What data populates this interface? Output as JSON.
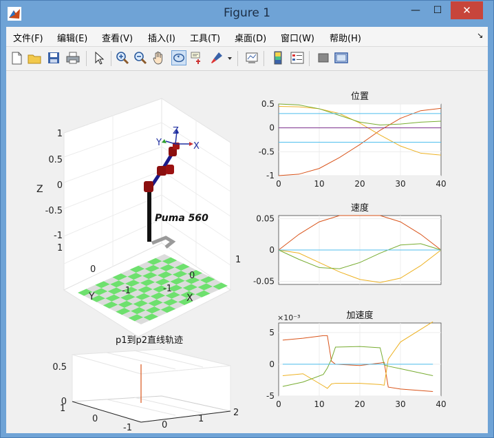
{
  "window": {
    "title": "Figure 1",
    "minimize": "—",
    "maximize": "☐",
    "close": "✕"
  },
  "menu": [
    "文件(F)",
    "编辑(E)",
    "查看(V)",
    "插入(I)",
    "工具(T)",
    "桌面(D)",
    "窗口(W)",
    "帮助(H)"
  ],
  "menu_arrow": "↘",
  "toolbar_icons": [
    "new-figure-icon",
    "open-file-icon",
    "save-icon",
    "print-icon",
    "pointer-icon",
    "zoom-in-icon",
    "zoom-out-icon",
    "pan-hand-icon",
    "rotate-3d-icon",
    "data-cursor-icon",
    "brush-icon",
    "brush-dropdown-icon",
    "link-plot-icon",
    "colorbar-icon",
    "legend-icon",
    "hide-plot-tools-icon",
    "show-plot-tools-icon"
  ],
  "robot": {
    "name": "Puma 560",
    "zlabel": "Z",
    "xlabel": "X",
    "ylabel": "Y",
    "ticks_z": [
      "1",
      "0.5",
      "0",
      "-0.5",
      "-1"
    ],
    "ticks_y": [
      "1",
      "0",
      "-1"
    ],
    "ticks_x": [
      "-1",
      "0",
      "1"
    ],
    "frame_labels": [
      "Z",
      "Y",
      "X"
    ]
  },
  "bottom3d": {
    "title": "p1到p2直线轨迹",
    "ticks_z": [
      "0.5",
      "0"
    ],
    "ticks_y": [
      "1",
      "0",
      "-1"
    ],
    "ticks_x": [
      "0",
      "1",
      "2"
    ]
  },
  "chart_data": [
    {
      "type": "line",
      "title": "位置",
      "xlim": [
        0,
        40
      ],
      "ylim": [
        -1,
        0.5
      ],
      "xticks": [
        "0",
        "10",
        "20",
        "30",
        "40"
      ],
      "yticks": [
        "0.5",
        "0",
        "-0.5",
        "-1"
      ],
      "grid": true,
      "x": [
        0,
        5,
        10,
        15,
        20,
        25,
        30,
        35,
        40
      ],
      "series": [
        {
          "color": "#d95319",
          "values": [
            -1,
            -0.97,
            -0.85,
            -0.62,
            -0.35,
            -0.05,
            0.2,
            0.36,
            0.41
          ]
        },
        {
          "color": "#edb120",
          "values": [
            0.45,
            0.44,
            0.4,
            0.3,
            0.1,
            -0.15,
            -0.38,
            -0.53,
            -0.57
          ]
        },
        {
          "color": "#77ac30",
          "values": [
            0.5,
            0.48,
            0.4,
            0.26,
            0.12,
            0.06,
            0.08,
            0.12,
            0.14
          ]
        },
        {
          "color": "#4dbeee",
          "values": [
            0.3,
            0.3,
            0.3,
            0.3,
            0.3,
            0.3,
            0.3,
            0.3,
            0.3
          ]
        },
        {
          "color": "#4dbeee",
          "values": [
            -0.3,
            -0.3,
            -0.3,
            -0.3,
            -0.3,
            -0.3,
            -0.3,
            -0.3,
            -0.3
          ]
        },
        {
          "color": "#7e2f8e",
          "values": [
            0,
            0,
            0,
            0,
            0,
            0,
            0,
            0,
            0
          ]
        }
      ]
    },
    {
      "type": "line",
      "title": "速度",
      "xlim": [
        0,
        40
      ],
      "ylim": [
        -0.055,
        0.055
      ],
      "xticks": [],
      "yticks": [
        "0.05",
        "0",
        "-0.05"
      ],
      "grid": true,
      "x": [
        0,
        5,
        10,
        15,
        20,
        25,
        30,
        35,
        40
      ],
      "series": [
        {
          "color": "#d95319",
          "values": [
            0,
            0.025,
            0.045,
            0.055,
            0.055,
            0.055,
            0.045,
            0.025,
            0
          ]
        },
        {
          "color": "#edb120",
          "values": [
            0,
            -0.005,
            -0.02,
            -0.035,
            -0.047,
            -0.052,
            -0.045,
            -0.025,
            0
          ]
        },
        {
          "color": "#77ac30",
          "values": [
            0,
            -0.015,
            -0.028,
            -0.03,
            -0.02,
            -0.005,
            0.008,
            0.01,
            0
          ]
        },
        {
          "color": "#4dbeee",
          "values": [
            0,
            0,
            0,
            0,
            0,
            0,
            0,
            0,
            0
          ]
        }
      ]
    },
    {
      "type": "line",
      "title": "加速度",
      "scale_label": "×10⁻³",
      "xlim": [
        0,
        40
      ],
      "ylim": [
        -5,
        6.5
      ],
      "xticks": [
        "0",
        "10",
        "20",
        "30",
        "40"
      ],
      "yticks": [
        "5",
        "0",
        "-5"
      ],
      "grid": true,
      "x": [
        1,
        6,
        11,
        12,
        13,
        14,
        20,
        25,
        26,
        27,
        30,
        38
      ],
      "series": [
        {
          "color": "#d95319",
          "values": [
            3.8,
            4.1,
            4.5,
            4.5,
            0.5,
            0,
            -0.2,
            0.2,
            0.3,
            -3.6,
            -3.9,
            -4.3
          ]
        },
        {
          "color": "#edb120",
          "values": [
            -1.8,
            -1.5,
            -3.4,
            -3.8,
            -3.1,
            -3,
            -3,
            -3.2,
            -3.3,
            0.8,
            3.5,
            6.7
          ]
        },
        {
          "color": "#77ac30",
          "values": [
            -3.5,
            -2.8,
            -1.6,
            -0.6,
            0.8,
            2.7,
            2.8,
            2.6,
            -0.1,
            -0.3,
            -0.7,
            -1.8
          ]
        },
        {
          "color": "#4dbeee",
          "values": [
            0,
            0,
            0,
            0,
            0,
            0,
            0,
            0,
            0,
            0,
            0,
            0
          ]
        }
      ]
    }
  ]
}
